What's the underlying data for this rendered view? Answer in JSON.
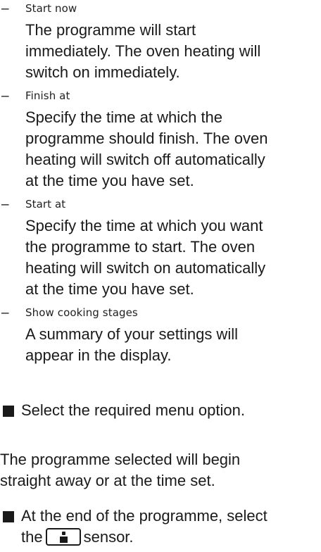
{
  "options": [
    {
      "label": "Start now",
      "description_lines": [
        "The programme will start",
        "immediately. The oven heating will",
        "switch on immediately."
      ]
    },
    {
      "label": "Finish at",
      "description_lines": [
        "Specify the time at which the",
        "programme should finish. The oven",
        "heating will switch off automatically",
        "at the time you have set."
      ]
    },
    {
      "label": "Start at",
      "description_lines": [
        "Specify the time at which you want",
        "the programme to start. The oven",
        "heating will switch on automatically",
        "at the time you have set."
      ]
    },
    {
      "label": "Show cooking stages",
      "description_lines": [
        "A summary of your settings will",
        "appear in the display."
      ]
    }
  ],
  "dash_symbol": "–",
  "instruction_select": "Select the required menu option.",
  "paragraph_lines": [
    "The programme selected will begin",
    "straight away or at the time set."
  ],
  "instruction_end_before": "At the end of the programme, select",
  "instruction_end_line2_before": "the",
  "instruction_end_line2_after": "sensor.",
  "sensor_icon": "info-sensor-icon"
}
